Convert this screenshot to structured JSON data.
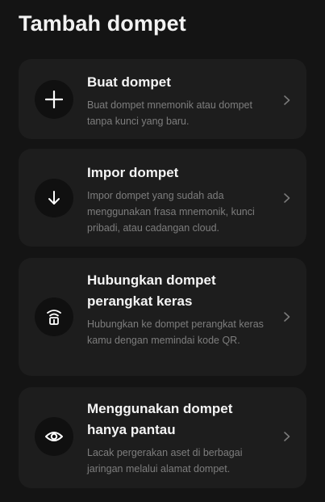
{
  "page": {
    "title": "Tambah dompet"
  },
  "options": [
    {
      "icon": "plus-icon",
      "title": "Buat dompet",
      "description": "Buat dompet mnemonik atau dompet tanpa kunci yang baru."
    },
    {
      "icon": "arrow-down-icon",
      "title": "Impor dompet",
      "description": "Impor dompet yang sudah ada menggunakan frasa mnemonik, kunci pribadi, atau cadangan cloud."
    },
    {
      "icon": "hardware-wallet-icon",
      "title": "Hubungkan dompet perangkat keras",
      "description": "Hubungkan ke dompet perangkat keras kamu dengan memindai kode QR."
    },
    {
      "icon": "eye-icon",
      "title": "Menggunakan dompet hanya pantau",
      "description": "Lacak pergerakan aset di berbagai jaringan melalui alamat dompet."
    }
  ],
  "colors": {
    "background": "#141414",
    "card": "#1d1d1d",
    "icon_circle": "#101010",
    "title_text": "#f4f4f4",
    "description_text": "#7d7d7d"
  }
}
